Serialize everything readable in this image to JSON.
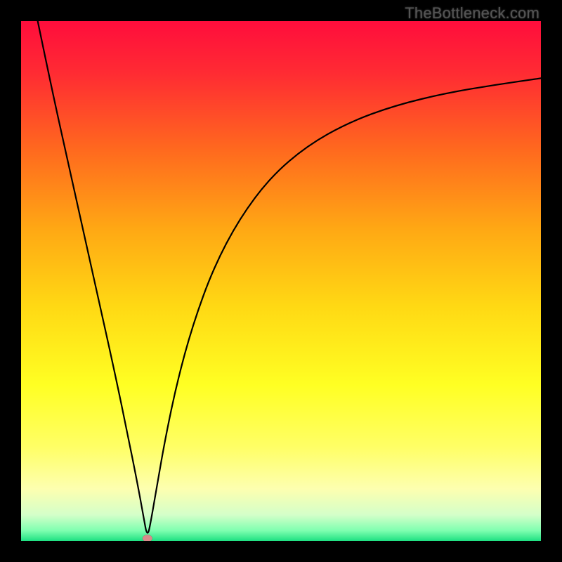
{
  "watermark": "TheBottleneck.com",
  "chart_data": {
    "type": "line",
    "title": "",
    "xlabel": "",
    "ylabel": "",
    "xlim": [
      0,
      1
    ],
    "ylim": [
      0,
      100
    ],
    "gradient_stops": [
      {
        "offset": 0.0,
        "color": "#ff0d3c"
      },
      {
        "offset": 0.1,
        "color": "#ff2b33"
      },
      {
        "offset": 0.25,
        "color": "#ff6a1e"
      },
      {
        "offset": 0.4,
        "color": "#ffa814"
      },
      {
        "offset": 0.55,
        "color": "#ffd914"
      },
      {
        "offset": 0.7,
        "color": "#ffff23"
      },
      {
        "offset": 0.82,
        "color": "#ffff66"
      },
      {
        "offset": 0.9,
        "color": "#fdffb0"
      },
      {
        "offset": 0.95,
        "color": "#d4ffc9"
      },
      {
        "offset": 0.98,
        "color": "#7fffb0"
      },
      {
        "offset": 1.0,
        "color": "#1ee082"
      }
    ],
    "min_marker": {
      "x": 0.243,
      "y": 0.5,
      "color": "#d98b8b"
    },
    "series": [
      {
        "name": "bottleneck-curve",
        "color": "#000000",
        "x": [
          0.032,
          0.06,
          0.09,
          0.12,
          0.15,
          0.18,
          0.205,
          0.223,
          0.235,
          0.243,
          0.251,
          0.262,
          0.278,
          0.3,
          0.33,
          0.37,
          0.42,
          0.48,
          0.55,
          0.63,
          0.72,
          0.82,
          0.91,
          1.0
        ],
        "y": [
          100.0,
          86.5,
          73.0,
          59.5,
          46.0,
          32.5,
          20.5,
          11.5,
          5.0,
          0.5,
          4.5,
          11.0,
          20.0,
          30.5,
          41.5,
          52.5,
          62.0,
          70.0,
          76.0,
          80.5,
          83.8,
          86.2,
          87.7,
          89.0
        ]
      }
    ]
  }
}
